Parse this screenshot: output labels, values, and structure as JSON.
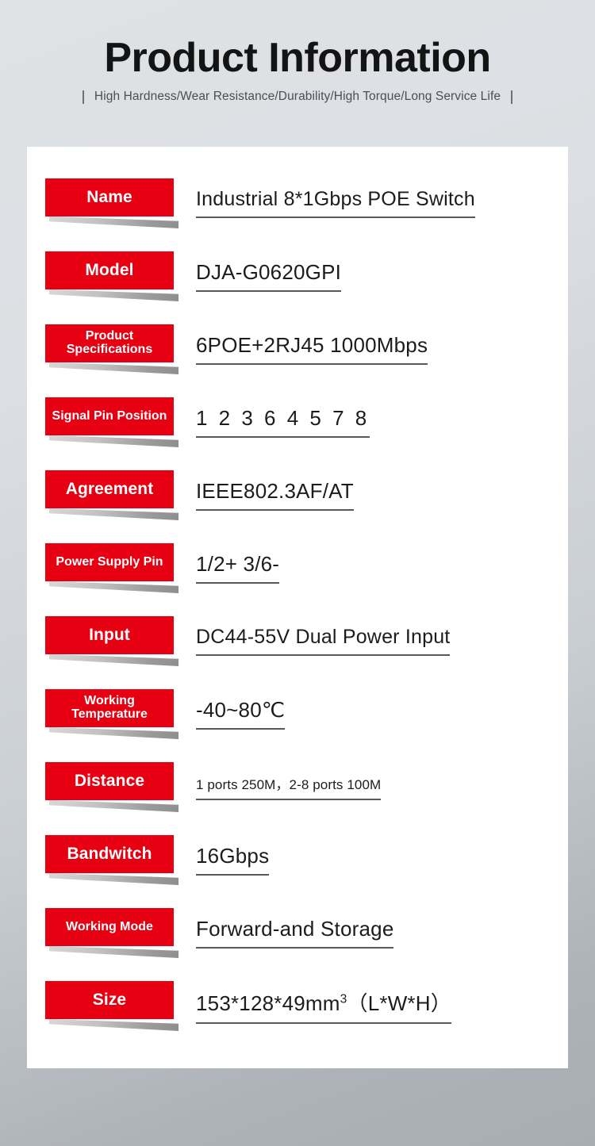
{
  "header": {
    "title": "Product Information",
    "subtitle": "High Hardness/Wear Resistance/Durability/High Torque/Long Service Life",
    "separator": "|"
  },
  "colors": {
    "tag_red": "#e60012",
    "background_top": "#dfe2e5",
    "background_bottom": "#a8adb4",
    "card": "#ffffff",
    "underline": "#55585c",
    "text": "#1c1c1c"
  },
  "spec_table": {
    "rows": [
      {
        "label": "Name",
        "value": "Industrial 8*1Gbps POE Switch"
      },
      {
        "label": "Model",
        "value": "DJA-G0620GPI"
      },
      {
        "label": "Product Specifications",
        "value": "6POE+2RJ45  1000Mbps"
      },
      {
        "label": "Signal Pin Position",
        "value": "1 2 3 6 4 5 7 8"
      },
      {
        "label": "Agreement",
        "value": "IEEE802.3AF/AT"
      },
      {
        "label": "Power Supply Pin",
        "value": "1/2+  3/6-"
      },
      {
        "label": "Input",
        "value": "DC44-55V Dual Power Input"
      },
      {
        "label": "Working Temperature",
        "value": "-40~80℃"
      },
      {
        "label": "Distance",
        "value": "1 ports 250M，2-8 ports 100M"
      },
      {
        "label": "Bandwitch",
        "value": "16Gbps"
      },
      {
        "label": "Working Mode",
        "value": "Forward-and Storage"
      },
      {
        "label": "Size",
        "value_html": "153*128*49mm<sup>3</sup>（L*W*H）"
      }
    ]
  }
}
